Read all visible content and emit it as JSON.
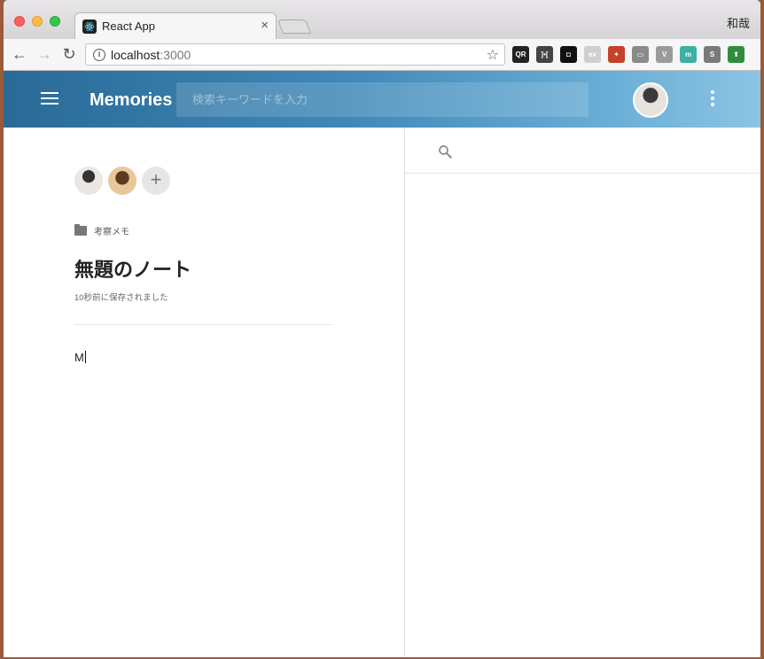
{
  "browser": {
    "tab_title": "React App",
    "tab_close": "×",
    "profile_name": "和哉",
    "url_host": "localhost",
    "url_port": ":3000",
    "info_icon": "i",
    "extensions": [
      {
        "name": "qr-url-extension",
        "label": "QR",
        "color": "#222222"
      },
      {
        "name": "bracket-extension",
        "label": "]•[",
        "color": "#444444"
      },
      {
        "name": "square-extension",
        "label": "◘",
        "color": "#111111"
      },
      {
        "name": "ex-extension",
        "label": "ex",
        "color": "#cfcfcf"
      },
      {
        "name": "red-extension",
        "label": "✦",
        "color": "#c7402a"
      },
      {
        "name": "chat-extension",
        "label": "▭",
        "color": "#8a8a8a"
      },
      {
        "name": "vue-extension",
        "label": "V",
        "color": "#9a9a9a"
      },
      {
        "name": "m-extension",
        "label": "m",
        "color": "#3bb0a4"
      },
      {
        "name": "s-extension",
        "label": "S",
        "color": "#7a7a7a"
      },
      {
        "name": "upload-extension",
        "label": "⬆",
        "color": "#2f8e3b"
      }
    ]
  },
  "app": {
    "title": "Memories",
    "search_placeholder": "検索キーワードを入力",
    "accent_color": "#3f88b8"
  },
  "editor": {
    "folder_label": "考察メモ",
    "note_title": "無題のノート",
    "saved_status": "10秒前に保存されました",
    "body_text": "M",
    "add_collaborator": "+"
  }
}
